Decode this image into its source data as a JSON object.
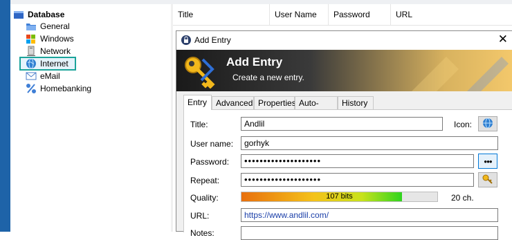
{
  "tree": {
    "root": "Database",
    "items": [
      {
        "label": "General",
        "icon": "folder-icon"
      },
      {
        "label": "Windows",
        "icon": "windows-logo-icon"
      },
      {
        "label": "Network",
        "icon": "network-server-icon"
      },
      {
        "label": "Internet",
        "icon": "globe-icon",
        "selected": true
      },
      {
        "label": "eMail",
        "icon": "email-icon"
      },
      {
        "label": "Homebanking",
        "icon": "percent-icon"
      }
    ]
  },
  "list": {
    "columns": [
      "Title",
      "User Name",
      "Password",
      "URL"
    ]
  },
  "dialog": {
    "window_title": "Add Entry",
    "close_glyph": "✕",
    "banner_title": "Add Entry",
    "banner_subtitle": "Create a new entry.",
    "tabs": [
      "Entry",
      "Advanced",
      "Properties",
      "Auto-Type",
      "History"
    ],
    "active_tab": "Entry",
    "fields": {
      "title_label": "Title:",
      "title_value": "Andlil",
      "icon_label": "Icon:",
      "username_label": "User name:",
      "username_value": "gorhyk",
      "password_label": "Password:",
      "password_value": "••••••••••••••••••••",
      "reveal_glyph": "●●●",
      "repeat_label": "Repeat:",
      "repeat_value": "••••••••••••••••••••",
      "quality_label": "Quality:",
      "quality_text": "107 bits",
      "quality_fraction": 0.82,
      "length_text": "20 ch.",
      "url_label": "URL:",
      "url_value": "https://www.andlil.com/",
      "notes_label": "Notes:"
    }
  },
  "colors": {
    "selection_outline": "#1aa39a",
    "url_text": "#1a3ea8",
    "accent": "#0078d7"
  }
}
